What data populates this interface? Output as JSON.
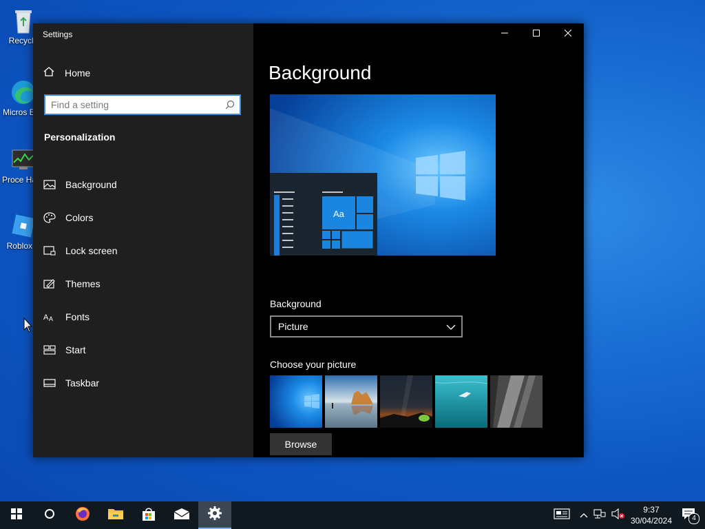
{
  "desktop": {
    "icons": [
      {
        "label": "Recycle",
        "name": "recycle-bin"
      },
      {
        "label": "Micros Edg",
        "name": "microsoft-edge"
      },
      {
        "label": "Proce Hack",
        "name": "process-hacker"
      },
      {
        "label": "Roblox S",
        "name": "roblox-studio"
      }
    ]
  },
  "window": {
    "title": "Settings",
    "home_label": "Home",
    "search_placeholder": "Find a setting",
    "section_header": "Personalization",
    "nav_items": [
      {
        "label": "Background",
        "icon": "picture-icon"
      },
      {
        "label": "Colors",
        "icon": "palette-icon"
      },
      {
        "label": "Lock screen",
        "icon": "lock-screen-icon"
      },
      {
        "label": "Themes",
        "icon": "themes-icon"
      },
      {
        "label": "Fonts",
        "icon": "fonts-icon"
      },
      {
        "label": "Start",
        "icon": "start-icon"
      },
      {
        "label": "Taskbar",
        "icon": "taskbar-icon"
      }
    ],
    "controls": [
      "minimize",
      "maximize",
      "close"
    ]
  },
  "main": {
    "page_title": "Background",
    "preview_tile_text": "Aa",
    "background_label": "Background",
    "background_value": "Picture",
    "choose_label": "Choose your picture",
    "thumbnails": [
      "windows-blue",
      "beach-rocks",
      "night-sky",
      "underwater-swimmer",
      "rock-cliff"
    ],
    "browse_label": "Browse"
  },
  "taskbar": {
    "apps": [
      "start",
      "search",
      "firefox",
      "file-explorer",
      "store",
      "mail",
      "settings"
    ],
    "active": "settings",
    "clock_time": "9:37",
    "clock_date": "30/04/2024",
    "notification_count": "4"
  },
  "colors": {
    "accent": "#0078d7",
    "sidebar_bg": "#1f1f1f",
    "content_bg": "#000000",
    "taskbar_bg": "#101820"
  }
}
